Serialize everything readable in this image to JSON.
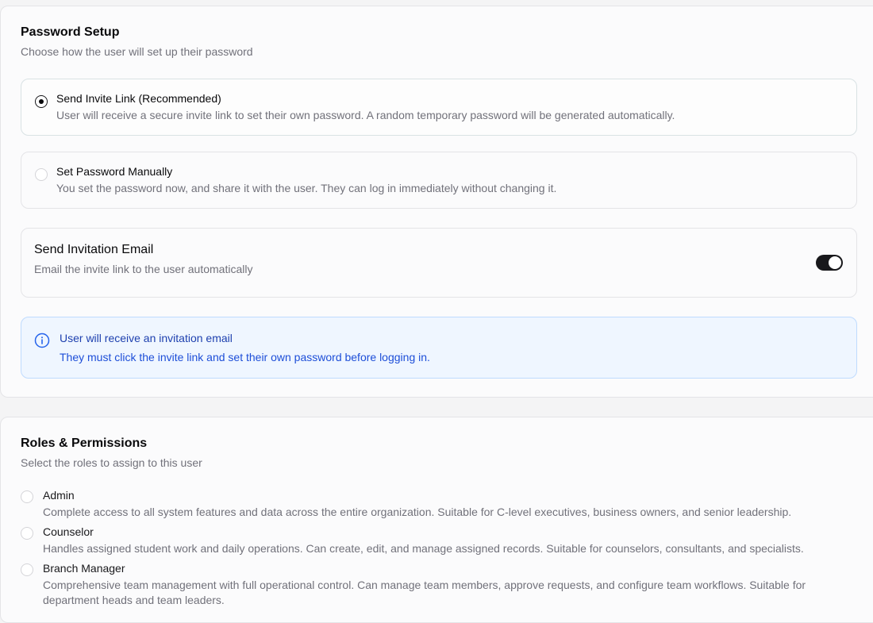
{
  "password_setup": {
    "title": "Password Setup",
    "subtitle": "Choose how the user will set up their password",
    "options": [
      {
        "label": "Send Invite Link (Recommended)",
        "description": "User will receive a secure invite link to set their own password. A random temporary password will be generated automatically.",
        "selected": true
      },
      {
        "label": "Set Password Manually",
        "description": "You set the password now, and share it with the user. They can log in immediately without changing it.",
        "selected": false
      }
    ],
    "invitation_email": {
      "title": "Send Invitation Email",
      "subtitle": "Email the invite link to the user automatically",
      "enabled": true
    },
    "info": {
      "icon": "info-circle-icon",
      "title": "User will receive an invitation email",
      "description": "They must click the invite link and set their own password before logging in."
    }
  },
  "roles": {
    "title": "Roles & Permissions",
    "subtitle": "Select the roles to assign to this user",
    "items": [
      {
        "label": "Admin",
        "description": "Complete access to all system features and data across the entire organization. Suitable for C-level executives, business owners, and senior leadership."
      },
      {
        "label": "Counselor",
        "description": "Handles assigned student work and daily operations. Can create, edit, and manage assigned records. Suitable for counselors, consultants, and specialists."
      },
      {
        "label": "Branch Manager",
        "description": "Comprehensive team management with full operational control. Can manage team members, approve requests, and configure team workflows. Suitable for department heads and team leaders."
      }
    ]
  },
  "colors": {
    "info_bg": "#eff6ff",
    "info_text": "#1d4ed8",
    "toggle_on": "#18181b"
  }
}
